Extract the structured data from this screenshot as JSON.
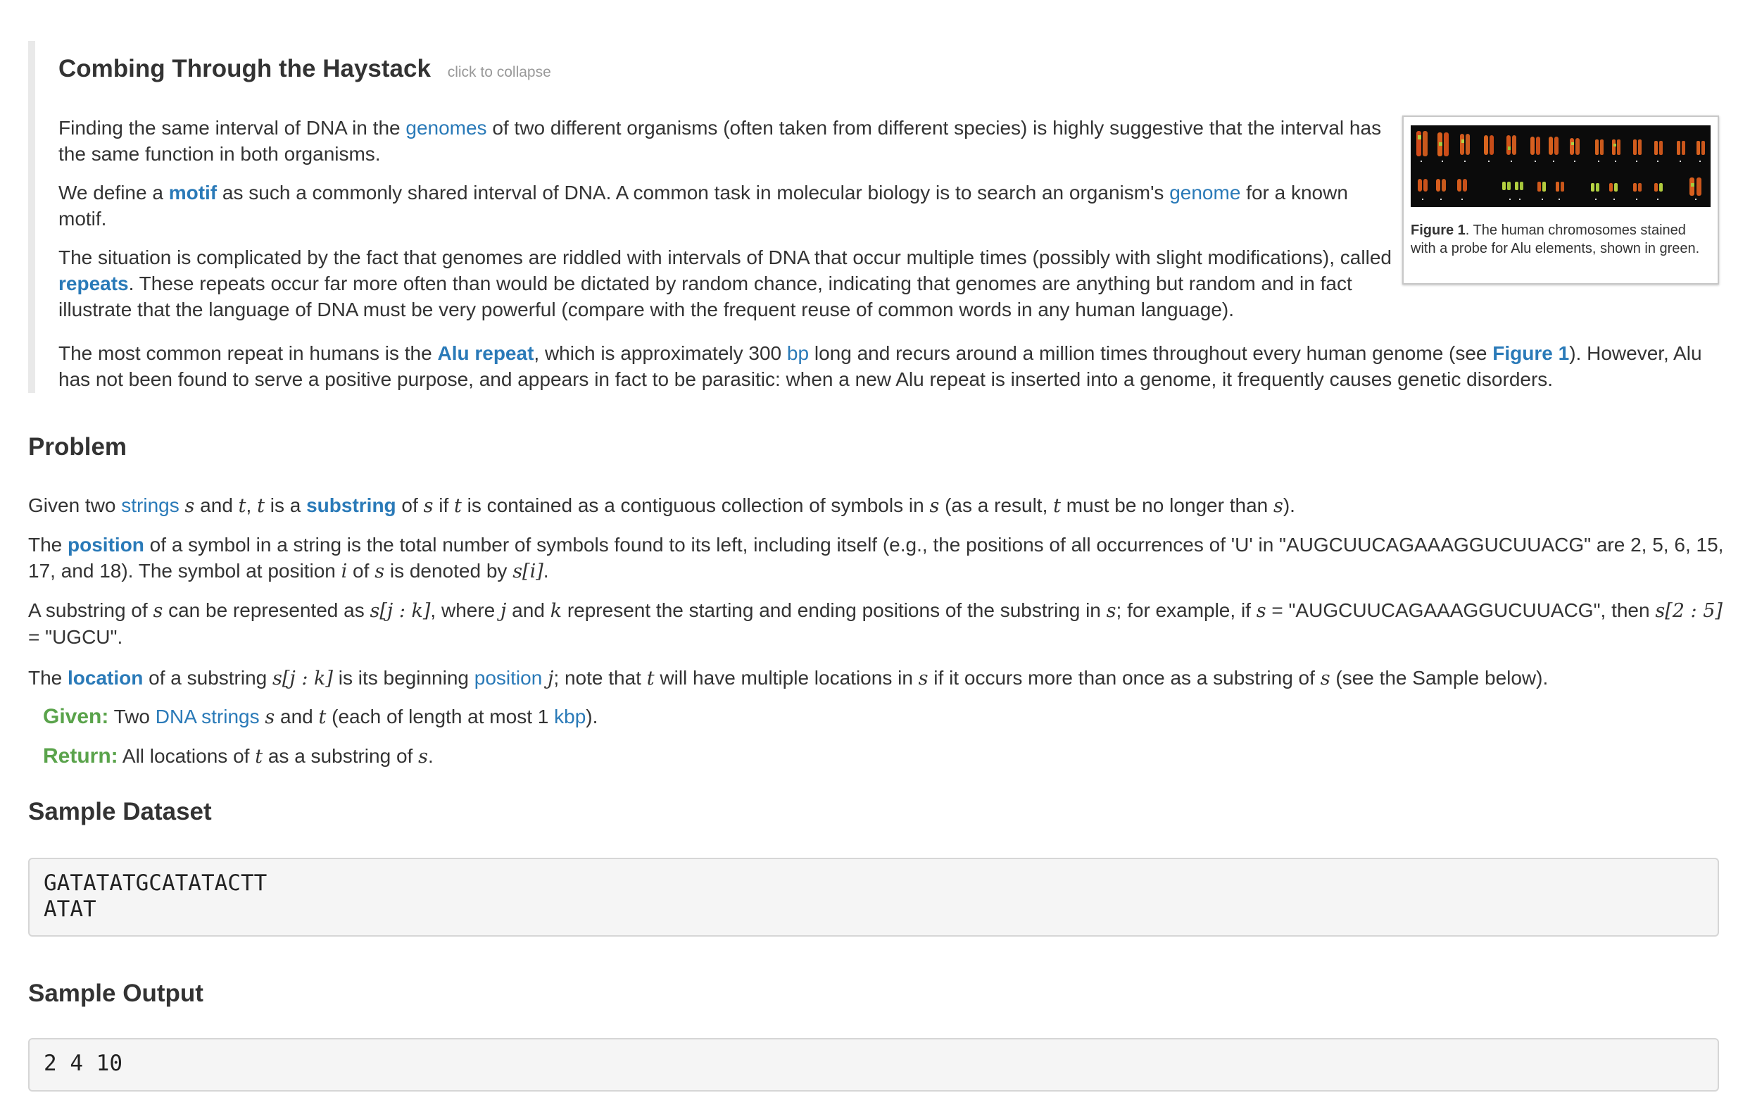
{
  "story": {
    "title": "Combing Through the Haystack",
    "collapse_label": "click to collapse",
    "p1": {
      "t1": "Finding the same interval of DNA in the ",
      "link1": "genomes",
      "t2": " of two different organisms (often taken from different species) is highly suggestive that the interval has the same function in both organisms."
    },
    "p2": {
      "t1": "We define a ",
      "link1": "motif",
      "t2": " as such a commonly shared interval of DNA. A common task in molecular biology is to search an organism's ",
      "link2": "genome",
      "t3": " for a known motif."
    },
    "p3": {
      "t1": "The situation is complicated by the fact that genomes are riddled with intervals of DNA that occur multiple times (possibly with slight modifications), called ",
      "link1": "repeats",
      "t2": ". These repeats occur far more often than would be dictated by random chance, indicating that genomes are anything but random and in fact illustrate that the language of DNA must be very powerful (compare with the frequent reuse of common words in any human language)."
    },
    "p4": {
      "t1": "The most common repeat in humans is the ",
      "link1": "Alu repeat",
      "t2": ", which is approximately 300 ",
      "link2": "bp",
      "t3": " long and recurs around a million times throughout every human genome (see ",
      "link3": "Figure 1",
      "t4": "). However, Alu has not been found to serve a positive purpose, and appears in fact to be parasitic: when a new Alu repeat is inserted into a genome, it frequently causes genetic disorders."
    },
    "figure": {
      "label": "Figure 1",
      "caption": ". The human chromosomes stained with a probe for Alu elements, shown in green."
    }
  },
  "problem": {
    "title": "Problem",
    "p1": {
      "t1": "Given two ",
      "link1": "strings",
      "t2": " and ",
      "t3": ", ",
      "t4": " is a ",
      "link2": "substring",
      "t5": " of ",
      "t6": " if ",
      "t7": " is contained as a contiguous collection of symbols in ",
      "t8": " (as a result, ",
      "t9": " must be no longer than ",
      "t10": ")."
    },
    "p2": {
      "t1": "The ",
      "link1": "position",
      "t2": " of a symbol in a string is the total number of symbols found to its left, including itself (e.g., the positions of all occurrences of 'U' in \"AUGCUUCAGAAAGGUCUUACG\" are 2, 5, 6, 15, 17, and 18). The symbol at position ",
      "t3": " of ",
      "t4": " is denoted by ",
      "t5": "."
    },
    "p3": {
      "t1": "A substring of ",
      "t2": " can be represented as ",
      "t3": ", where ",
      "t4": " and ",
      "t5": " represent the starting and ending positions of the substring in ",
      "t6": "; for example, if ",
      "t7": " = \"AUGCUUCAGAAAGGUCUUACG\", then ",
      "t8": " = \"UGCU\"."
    },
    "p4": {
      "t1": "The ",
      "link1": "location",
      "t2": " of a substring ",
      "t3": " is its beginning ",
      "link2": "position",
      "t4": "; note that ",
      "t5": " will have multiple locations in ",
      "t6": " if it occurs more than once as a substring of ",
      "t7": " (see the Sample below)."
    },
    "given": {
      "label": "Given:",
      "t1": " Two ",
      "link1": "DNA strings",
      "t2": " and ",
      "t3": " (each of length at most 1 ",
      "link2": "kbp",
      "t4": ")."
    },
    "return": {
      "label": "Return:",
      "t1": " All locations of ",
      "t2": " as a substring of ",
      "t3": "."
    },
    "math": {
      "s": "s",
      "t": "t",
      "i": "i",
      "j": "j",
      "k": "k",
      "s_i": "s[i]",
      "s_jk": "s[j : k]",
      "s_25": "s[2 : 5]"
    }
  },
  "sample_dataset": {
    "title": "Sample Dataset",
    "lines": [
      "GATATATGCATATACTT",
      "ATAT"
    ]
  },
  "sample_output": {
    "title": "Sample Output",
    "lines": [
      "2 4 10"
    ]
  },
  "colors": {
    "link": "#2a7ab8",
    "given_return_label": "#5aa34b",
    "text": "#333333",
    "story_border": "#e9e9e9",
    "code_background": "#f5f5f5",
    "collapse_link": "#999999"
  }
}
